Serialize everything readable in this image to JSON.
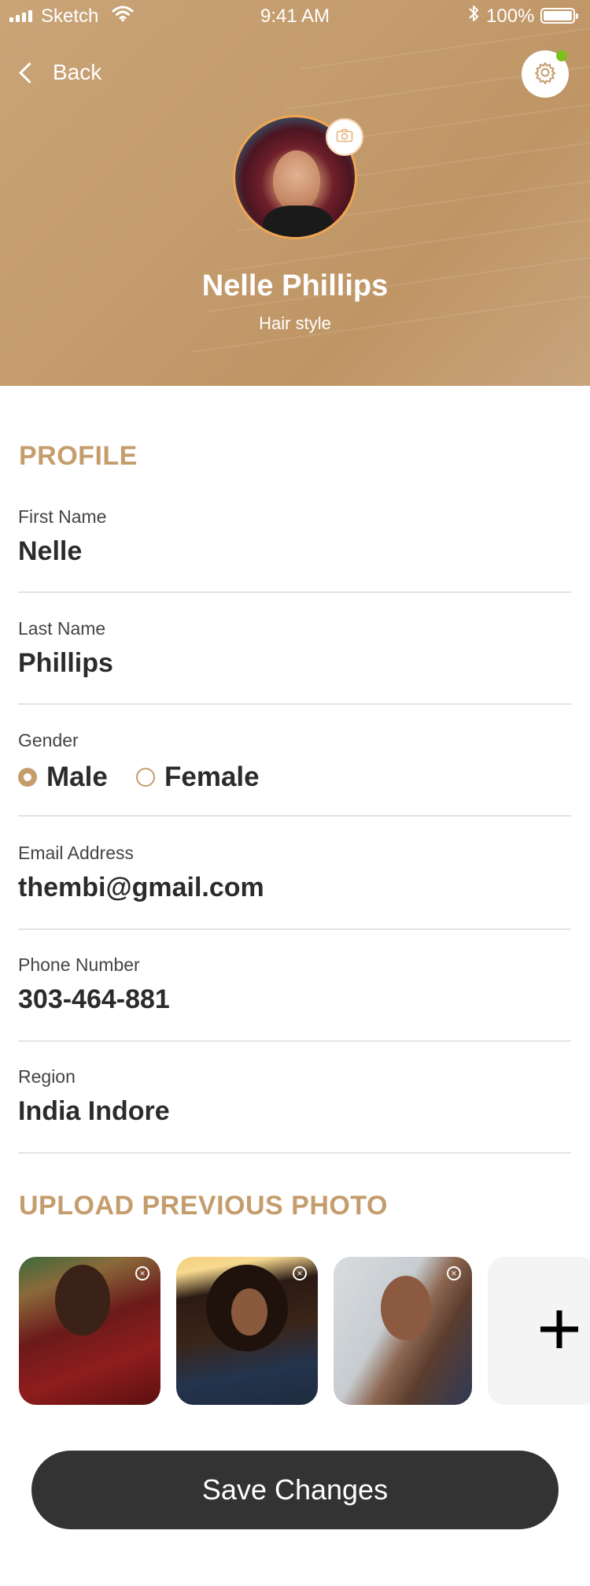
{
  "status_bar": {
    "carrier": "Sketch",
    "time": "9:41 AM",
    "battery": "100%"
  },
  "header": {
    "back_label": "Back",
    "name": "Nelle Phillips",
    "subtitle": "Hair style",
    "background_color": "#c49c6e",
    "online_dot_color": "#7dc11f"
  },
  "profile": {
    "section_title": "PROFILE",
    "fields": [
      {
        "label": "First Name",
        "value": "Nelle"
      },
      {
        "label": "Last Name",
        "value": "Phillips"
      },
      {
        "label": "Email Address",
        "value": "thembi@gmail.com"
      },
      {
        "label": "Phone Number",
        "value": "303-464-881"
      },
      {
        "label": "Region",
        "value": "India Indore"
      }
    ],
    "gender": {
      "label": "Gender",
      "options": [
        "Male",
        "Female"
      ],
      "selected": "Male"
    }
  },
  "upload": {
    "section_title": "UPLOAD PREVIOUS PHOTO",
    "photos": [
      "photo-1",
      "photo-2",
      "photo-3"
    ],
    "add_icon": "plus-icon"
  },
  "actions": {
    "save_label": "Save Changes",
    "button_color": "#333333"
  },
  "theme": {
    "accent": "#c59d6d",
    "avatar_ring": "#f0a553"
  }
}
